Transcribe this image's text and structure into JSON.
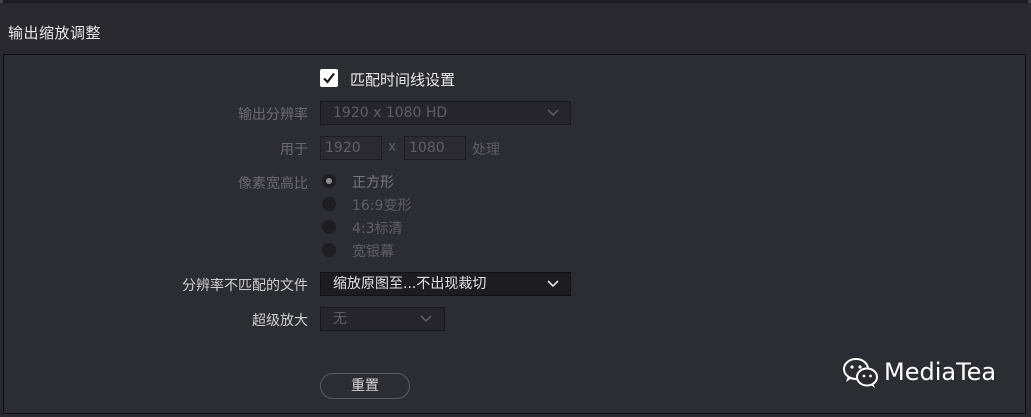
{
  "section": {
    "title": "输出缩放调整"
  },
  "match_timeline": {
    "label": "匹配时间线设置",
    "checked": true
  },
  "output_resolution": {
    "label": "输出分辨率",
    "value": "1920 x 1080 HD"
  },
  "process_at": {
    "label": "用于",
    "width": "1920",
    "separator": "x",
    "height": "1080",
    "suffix": "处理"
  },
  "pixel_aspect": {
    "label": "像素宽高比",
    "options": [
      "正方形",
      "16:9变形",
      "4:3标清",
      "宽银幕"
    ],
    "selected": "正方形"
  },
  "mismatched_resolution": {
    "label": "分辨率不匹配的文件",
    "value": "缩放原图至...不出现裁切"
  },
  "super_scale": {
    "label": "超级放大",
    "value": "无"
  },
  "reset_button": {
    "label": "重置"
  },
  "watermark": {
    "text": "MediaTea",
    "icon": "wechat-icon"
  },
  "colors": {
    "panel": "#2c2c33",
    "background": "#28282e",
    "checkbox": "#ffffff"
  }
}
